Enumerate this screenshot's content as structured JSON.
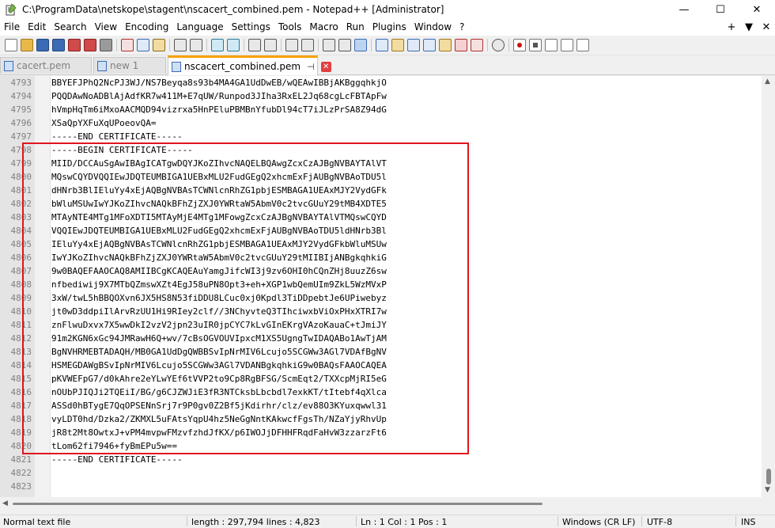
{
  "window": {
    "title": "C:\\ProgramData\\netskope\\stagent\\nscacert_combined.pem - Notepad++ [Administrator]",
    "controls": {
      "minimize": "—",
      "maximize": "☐",
      "close": "✕"
    }
  },
  "menubar": {
    "items": [
      "File",
      "Edit",
      "Search",
      "View",
      "Encoding",
      "Language",
      "Settings",
      "Tools",
      "Macro",
      "Run",
      "Plugins",
      "Window",
      "?"
    ],
    "right": [
      "+",
      "▼",
      "✕"
    ]
  },
  "tabs": [
    {
      "label": "cacert.pem",
      "active": false,
      "icon": "file-icon"
    },
    {
      "label": "new 1",
      "active": false,
      "icon": "file-icon"
    },
    {
      "label": "nscacert_combined.pem",
      "active": true,
      "icon": "file-saved-icon",
      "pin": "📌",
      "close": "✕"
    }
  ],
  "editor": {
    "lines": [
      {
        "num": "4793",
        "text": "BBYEFJPhQ2NcPJ3WJ/NS7Beyqa8s93b4MA4GA1UdDwEB/wQEAwIBBjAKBggqhkjO"
      },
      {
        "num": "4794",
        "text": "PQQDAwNoADBlAjAdfKR7w411M+E7qUW/Runpod3JIha3RxEL2Jq68cgLcFBTApFw"
      },
      {
        "num": "4795",
        "text": "hVmpHqTm6iMxoAACMQD94vizrxa5HnPEluPBMBnYfubDl94cT7iJLzPrSA8Z94dG"
      },
      {
        "num": "4796",
        "text": "XSaQpYXFuXqUPoeovQA="
      },
      {
        "num": "4797",
        "text": "-----END CERTIFICATE-----"
      },
      {
        "num": "4798",
        "text": "-----BEGIN CERTIFICATE-----"
      },
      {
        "num": "4799",
        "text": "MIID/DCCAuSgAwIBAgICATgwDQYJKoZIhvcNAQELBQAwgZcxCzAJBgNVBAYTAlVT"
      },
      {
        "num": "4800",
        "text": "MQswCQYDVQQIEwJDQTEUMBIGA1UEBxMLU2FudGEgQ2xhcmExFjAUBgNVBAoTDU5l"
      },
      {
        "num": "4801",
        "text": "dHNrb3BlIEluYy4xEjAQBgNVBAsTCWNlcnRhZG1pbjESMBAGA1UEAxMJY2VydGFk"
      },
      {
        "num": "4802",
        "text": "bWluMSUwIwYJKoZIhvcNAQkBFhZjZXJ0YWRtaW5AbmV0c2tvcGUuY29tMB4XDTE5"
      },
      {
        "num": "4803",
        "text": "MTAyNTE4MTg1MFoXDTI5MTAyMjE4MTg1MFowgZcxCzAJBgNVBAYTAlVTMQswCQYD"
      },
      {
        "num": "4804",
        "text": "VQQIEwJDQTEUMBIGA1UEBxMLU2FudGEgQ2xhcmExFjAUBgNVBAoTDU5ldHNrb3Bl"
      },
      {
        "num": "4805",
        "text": "IEluYy4xEjAQBgNVBAsTCWNlcnRhZG1pbjESMBAGA1UEAxMJY2VydGFkbWluMSUw"
      },
      {
        "num": "4806",
        "text": "IwYJKoZIhvcNAQkBFhZjZXJ0YWRtaW5AbmV0c2tvcGUuY29tMIIBIjANBgkqhkiG"
      },
      {
        "num": "4807",
        "text": "9w0BAQEFAAOCAQ8AMIIBCgKCAQEAuYamgJifcWI3j9zv6OHI0hCQnZHj8uuzZ6sw"
      },
      {
        "num": "4808",
        "text": "nfbediwij9X7MTbQZmswXZt4EgJ58uPN8Opt3+eh+XGP1wbQemUIm9ZkL5WzMVxP"
      },
      {
        "num": "4809",
        "text": "3xW/twL5hBBQOXvn6JX5HS8N53fiDDU8LCuc0xj0Kpdl3TiDDpebtJe6UPiwebyz"
      },
      {
        "num": "4810",
        "text": "jt0wD3ddpiIlArvRzUU1Hi9RIey2clf//3NChyvteQ3TIhciwxbViOxPHxXTRI7w"
      },
      {
        "num": "4811",
        "text": "znFlwuDxvx7X5wwDkI2vzV2jpn23uIR0jpCYC7kLvGInEKrgVAzoKauaC+tJmiJY"
      },
      {
        "num": "4812",
        "text": "91m2KGN6xGc94JMRawH6Q+wv/7cBsOGVOUVIpxcM1XS5UgngTwIDAQABo1AwTjAM"
      },
      {
        "num": "4813",
        "text": "BgNVHRMEBTADAQH/MB0GA1UdDgQWBBSvIpNrMIV6Lcujo5SCGWw3AGl7VDAfBgNV"
      },
      {
        "num": "4814",
        "text": "HSMEGDAWgBSvIpNrMIV6Lcujo5SCGWw3AGl7VDANBgkqhkiG9w0BAQsFAAOCAQEA"
      },
      {
        "num": "4815",
        "text": "pKVWEFpG7/d0kAhre2eYLwYEf6tVVP2to9Cp8RgBFSG/ScmEqt2/TXXcpMjRI5eG"
      },
      {
        "num": "4816",
        "text": "nOUbPJIQJi2TQEiI/BG/g6CJZWJiE3fR3NTCksbLbcbdl7exkKT/tItebf4qXlca"
      },
      {
        "num": "4817",
        "text": "ASSd0hBTygE7QqOPSENnSrj7r9P0gv0Z2Bf5jKdirhr/clz/ev88O3KYuxqwwl31"
      },
      {
        "num": "4818",
        "text": "vyLDT0hd/Dzka2/ZKMXL5uFAtsYqpU4hz5NeGgNntKAkwcfFgsTh/NZaYjyRhvUp"
      },
      {
        "num": "4819",
        "text": "jR8t2Mt8OwtxJ+vPM4mvpwFMzvfzhdJfKX/p6IWOJjDFHHFRqdFaHvW3zzarzFt6"
      },
      {
        "num": "4820",
        "text": "tLom62fi7946+fyBmEPu5w=="
      },
      {
        "num": "4821",
        "text": "-----END CERTIFICATE-----"
      },
      {
        "num": "4822",
        "text": ""
      },
      {
        "num": "4823",
        "text": ""
      }
    ]
  },
  "statusbar": {
    "file_type": "Normal text file",
    "length": "length : 297,794    lines : 4,823",
    "position": "Ln : 1    Col : 1    Pos : 1",
    "eol": "Windows (CR LF)",
    "encoding": "UTF-8",
    "mode": "INS"
  },
  "colors": {
    "highlight_border": "#e0141e",
    "active_tab_accent": "#f7a000"
  }
}
